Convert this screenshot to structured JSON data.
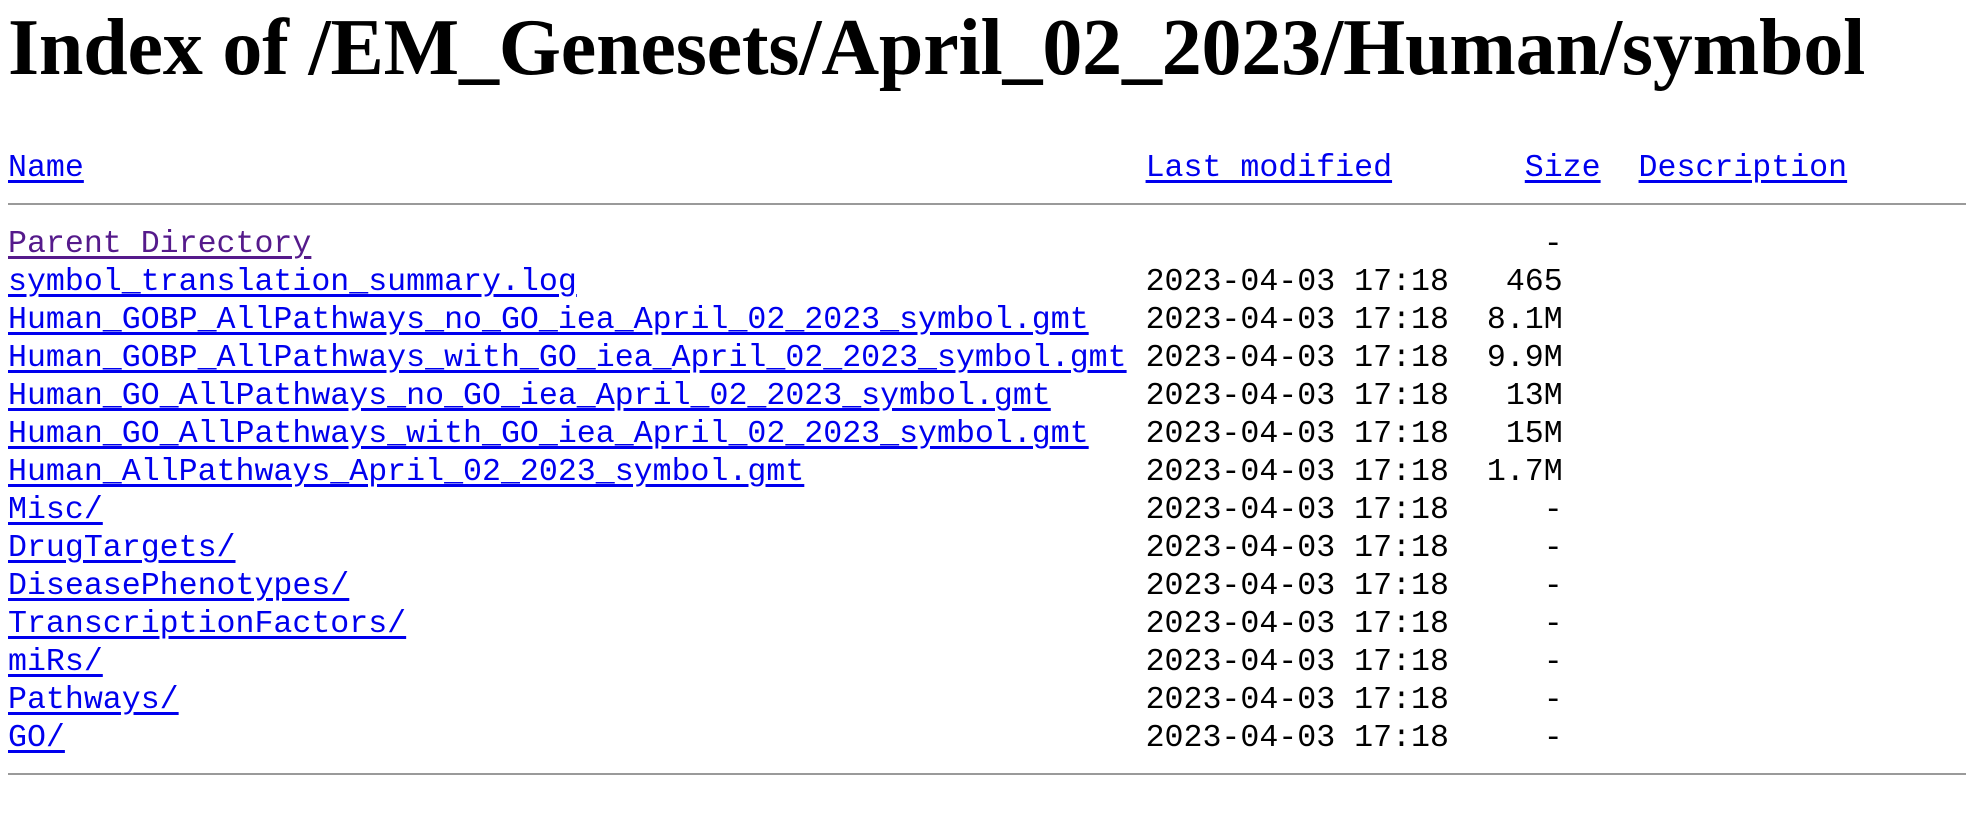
{
  "page": {
    "title": "Index of /EM_Genesets/April_02_2023/Human/symbol"
  },
  "columns": {
    "name": "Name",
    "last_modified": "Last modified",
    "size": "Size",
    "description": "Description"
  },
  "entries": [
    {
      "name": "Parent Directory",
      "modified": "",
      "size": "-"
    },
    {
      "name": "symbol_translation_summary.log",
      "modified": "2023-04-03 17:18",
      "size": "465"
    },
    {
      "name": "Human_GOBP_AllPathways_no_GO_iea_April_02_2023_symbol.gmt",
      "modified": "2023-04-03 17:18",
      "size": "8.1M"
    },
    {
      "name": "Human_GOBP_AllPathways_with_GO_iea_April_02_2023_symbol.gmt",
      "modified": "2023-04-03 17:18",
      "size": "9.9M"
    },
    {
      "name": "Human_GO_AllPathways_no_GO_iea_April_02_2023_symbol.gmt",
      "modified": "2023-04-03 17:18",
      "size": "13M"
    },
    {
      "name": "Human_GO_AllPathways_with_GO_iea_April_02_2023_symbol.gmt",
      "modified": "2023-04-03 17:18",
      "size": "15M"
    },
    {
      "name": "Human_AllPathways_April_02_2023_symbol.gmt",
      "modified": "2023-04-03 17:18",
      "size": "1.7M"
    },
    {
      "name": "Misc/",
      "modified": "2023-04-03 17:18",
      "size": "-"
    },
    {
      "name": "DrugTargets/",
      "modified": "2023-04-03 17:18",
      "size": "-"
    },
    {
      "name": "DiseasePhenotypes/",
      "modified": "2023-04-03 17:18",
      "size": "-"
    },
    {
      "name": "TranscriptionFactors/",
      "modified": "2023-04-03 17:18",
      "size": "-"
    },
    {
      "name": "miRs/",
      "modified": "2023-04-03 17:18",
      "size": "-"
    },
    {
      "name": "Pathways/",
      "modified": "2023-04-03 17:18",
      "size": "-"
    },
    {
      "name": "GO/",
      "modified": "2023-04-03 17:18",
      "size": "-"
    }
  ],
  "colors": {
    "link": "#0000ee",
    "visited_link": "#551a8b",
    "rule": "#9a9a9a"
  }
}
